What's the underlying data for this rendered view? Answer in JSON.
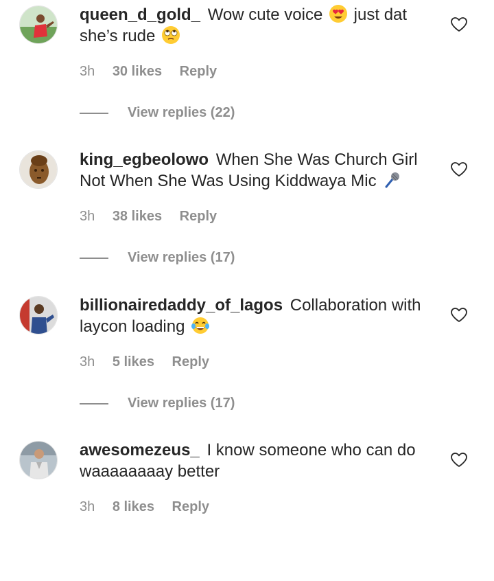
{
  "comments": [
    {
      "username": "queen_d_gold_",
      "text_part1": "Wow cute voice",
      "emoji1": "heart-eyes-emoji",
      "text_part2": "just dat she’s rude",
      "emoji2": "eye-roll-emoji",
      "time": "3h",
      "likes": "30 likes",
      "reply_label": "Reply",
      "view_replies": "View replies (22)"
    },
    {
      "username": "king_egbeolowo",
      "text_part1": "When She Was Church Girl Not When She Was Using Kiddwaya Mic",
      "emoji1": "microphone-emoji",
      "time": "3h",
      "likes": "38 likes",
      "reply_label": "Reply",
      "view_replies": "View replies (17)"
    },
    {
      "username": "billionairedaddy_of_lagos",
      "text_part1": "Collaboration with laycon loading",
      "emoji1": "tears-of-joy-emoji",
      "time": "3h",
      "likes": "5 likes",
      "reply_label": "Reply",
      "view_replies": "View replies (17)"
    },
    {
      "username": "awesomezeus_",
      "text_part1": "I know someone who can do waaaaaaaay better",
      "time": "3h",
      "likes": "8 likes",
      "reply_label": "Reply"
    }
  ],
  "colors": {
    "primary_text": "#262626",
    "secondary_text": "#8e8e8e",
    "background": "#ffffff"
  }
}
